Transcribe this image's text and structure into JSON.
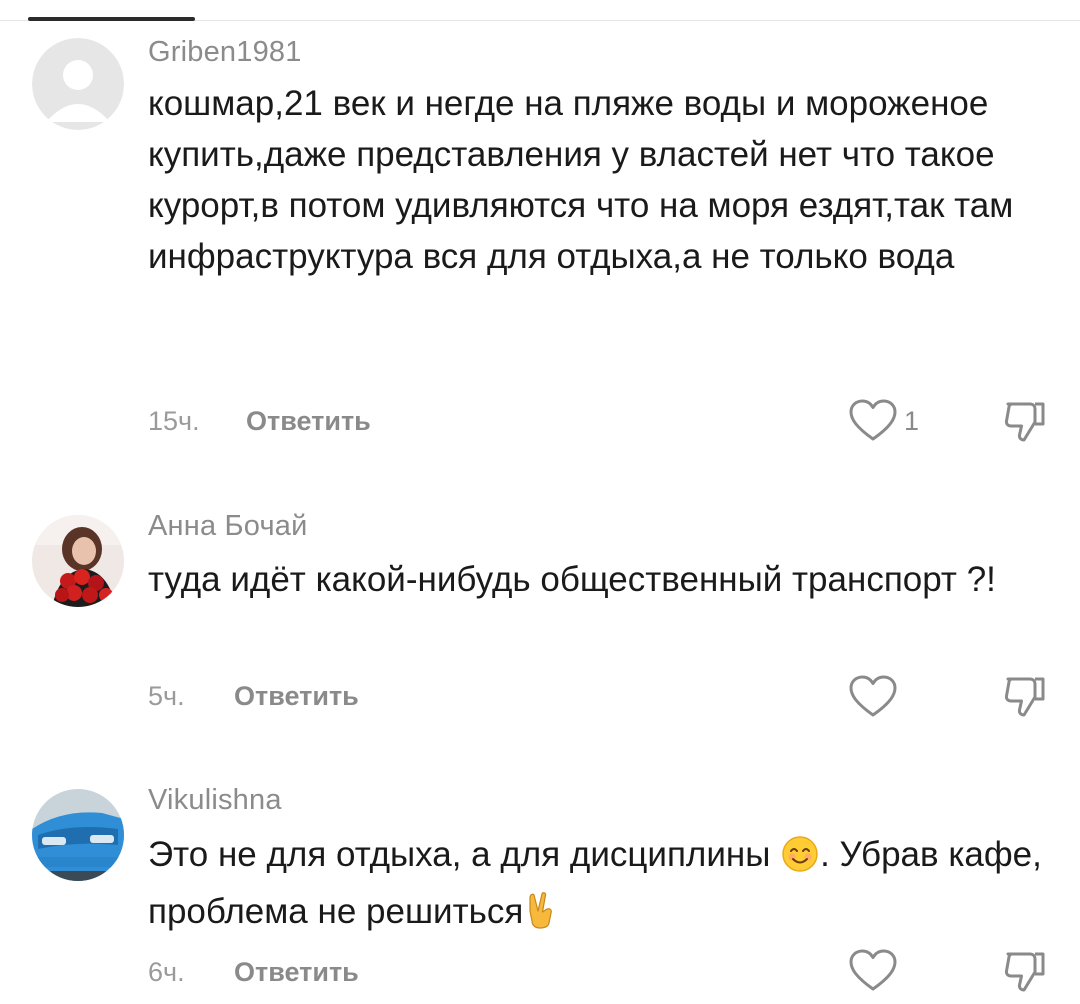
{
  "comments": [
    {
      "username": "Griben1981",
      "text": "кошмар,21 век и негде на пляже воды и мороженое купить,даже представления у властей нет что такое курорт,в потом удивляются что на моря ездят,так там инфраструктура вся для отдыха,а не только вода",
      "time": "15ч.",
      "reply_label": "Ответить",
      "like_count": "1",
      "avatar": "default-avatar"
    },
    {
      "username": "Анна Бочай",
      "text": "туда идёт какой-нибудь общественный транспорт ?!",
      "time": "5ч.",
      "reply_label": "Ответить",
      "like_count": "",
      "avatar": "photo-woman-roses"
    },
    {
      "username": "Vikulishna",
      "text_part1": "Это не для отдыха, а для дисциплины ",
      "text_part2": ". Убрав кафе, проблема не решиться",
      "emoji1": "smiling-face-emoji",
      "emoji2": "victory-hand-emoji",
      "time": "6ч.",
      "reply_label": "Ответить",
      "like_count": "",
      "avatar": "photo-blue-car"
    }
  ],
  "icons": {
    "like": "heart-outline-icon",
    "dislike": "thumbs-down-outline-icon"
  },
  "colors": {
    "username": "#8b8b8b",
    "meta": "#9a9a9a",
    "text": "#1a1a1a",
    "icon": "#8a8a8a"
  }
}
